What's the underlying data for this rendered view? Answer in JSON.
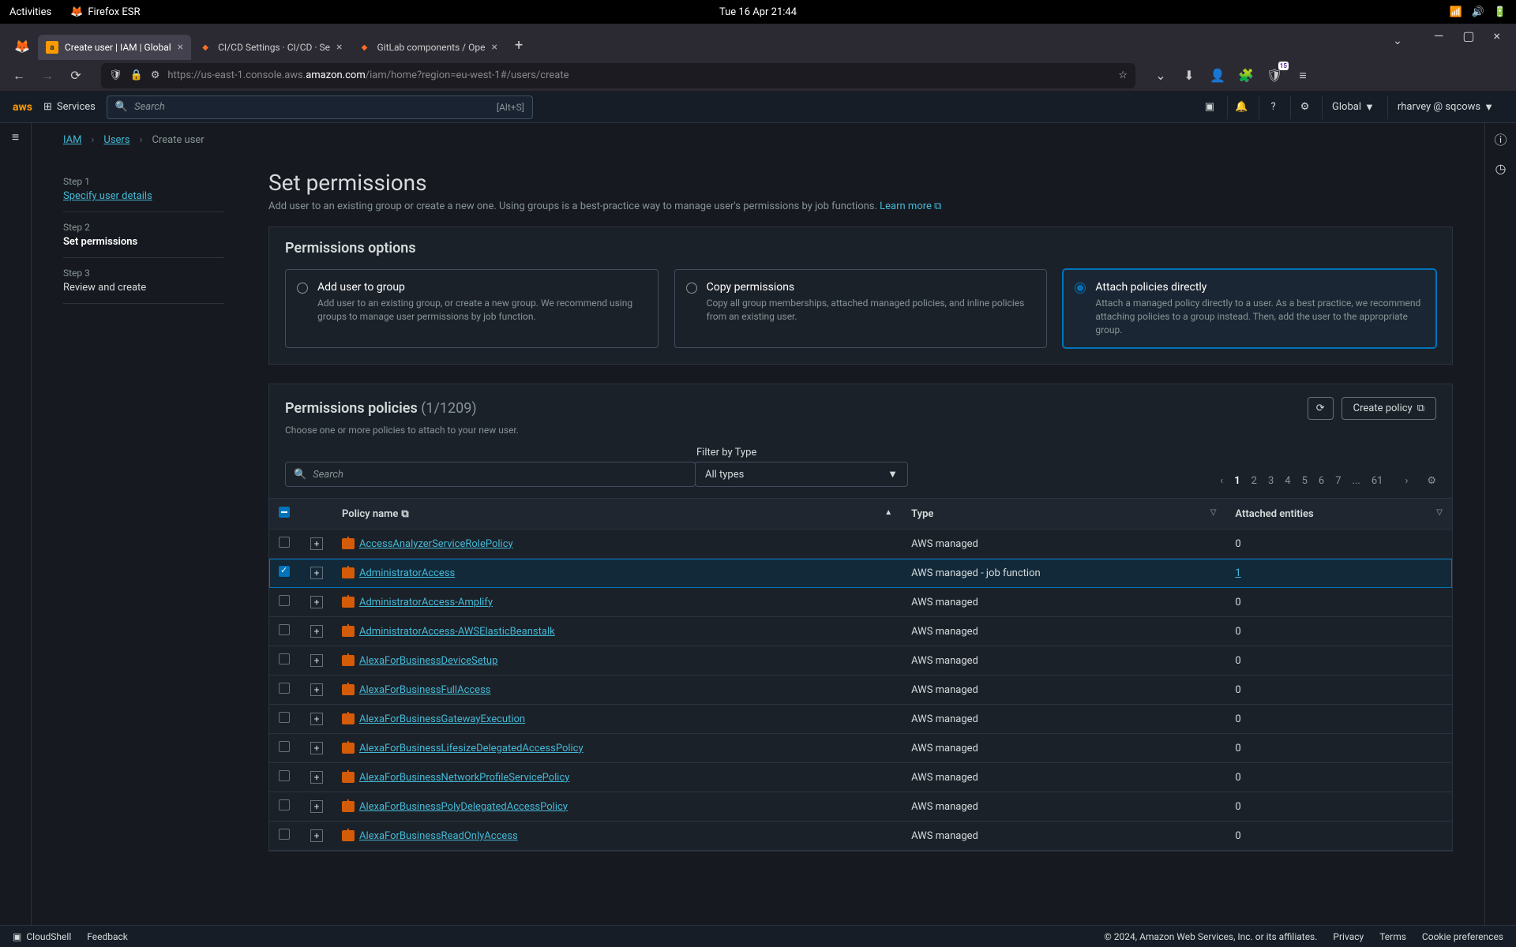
{
  "gnome": {
    "activities": "Activities",
    "app": "Firefox ESR",
    "clock": "Tue 16 Apr  21:44"
  },
  "firefox": {
    "tabs": [
      {
        "title": "Create user | IAM | Global",
        "fav": "aws"
      },
      {
        "title": "CI/CD Settings · CI/CD · Se",
        "fav": "gl"
      },
      {
        "title": "GitLab components / Ope",
        "fav": "gl"
      }
    ],
    "url_pre": "https://us-east-1.console.aws.",
    "url_host": "amazon.com",
    "url_post": "/iam/home?region=eu-west-1#/users/create",
    "ext_badge": "15"
  },
  "aws_header": {
    "services": "Services",
    "search_placeholder": "Search",
    "search_shortcut": "[Alt+S]",
    "region": "Global",
    "account": "rharvey @ sqcows"
  },
  "breadcrumbs": {
    "iam": "IAM",
    "users": "Users",
    "create": "Create user"
  },
  "wizard": {
    "steps": [
      {
        "label": "Step 1",
        "title": "Specify user details",
        "state": "link"
      },
      {
        "label": "Step 2",
        "title": "Set permissions",
        "state": "active"
      },
      {
        "label": "Step 3",
        "title": "Review and create",
        "state": "future"
      }
    ]
  },
  "page": {
    "title": "Set permissions",
    "subtitle_pre": "Add user to an existing group or create a new one. Using groups is a best-practice way to manage user's permissions by job functions. ",
    "learn_more": "Learn more"
  },
  "perm_options": {
    "heading": "Permissions options",
    "cards": [
      {
        "title": "Add user to group",
        "desc": "Add user to an existing group, or create a new group. We recommend using groups to manage user permissions by job function."
      },
      {
        "title": "Copy permissions",
        "desc": "Copy all group memberships, attached managed policies, and inline policies from an existing user."
      },
      {
        "title": "Attach policies directly",
        "desc": "Attach a managed policy directly to a user. As a best practice, we recommend attaching policies to a group instead. Then, add the user to the appropriate group."
      }
    ],
    "selected": 2
  },
  "policies_panel": {
    "heading": "Permissions policies",
    "count": "(1/1209)",
    "sub": "Choose one or more policies to attach to your new user.",
    "create_btn": "Create policy",
    "filter_label": "Filter by Type",
    "search_placeholder": "Search",
    "type_value": "All types",
    "pages": [
      "1",
      "2",
      "3",
      "4",
      "5",
      "6",
      "7",
      "...",
      "61"
    ],
    "columns": {
      "policy": "Policy name",
      "type": "Type",
      "entities": "Attached entities"
    },
    "rows": [
      {
        "name": "AccessAnalyzerServiceRolePolicy",
        "type": "AWS managed",
        "entities": "0",
        "checked": false
      },
      {
        "name": "AdministratorAccess",
        "type": "AWS managed - job function",
        "entities": "1",
        "checked": true,
        "entities_link": true
      },
      {
        "name": "AdministratorAccess-Amplify",
        "type": "AWS managed",
        "entities": "0",
        "checked": false
      },
      {
        "name": "AdministratorAccess-AWSElasticBeanstalk",
        "type": "AWS managed",
        "entities": "0",
        "checked": false
      },
      {
        "name": "AlexaForBusinessDeviceSetup",
        "type": "AWS managed",
        "entities": "0",
        "checked": false
      },
      {
        "name": "AlexaForBusinessFullAccess",
        "type": "AWS managed",
        "entities": "0",
        "checked": false
      },
      {
        "name": "AlexaForBusinessGatewayExecution",
        "type": "AWS managed",
        "entities": "0",
        "checked": false
      },
      {
        "name": "AlexaForBusinessLifesizeDelegatedAccessPolicy",
        "type": "AWS managed",
        "entities": "0",
        "checked": false
      },
      {
        "name": "AlexaForBusinessNetworkProfileServicePolicy",
        "type": "AWS managed",
        "entities": "0",
        "checked": false
      },
      {
        "name": "AlexaForBusinessPolyDelegatedAccessPolicy",
        "type": "AWS managed",
        "entities": "0",
        "checked": false
      },
      {
        "name": "AlexaForBusinessReadOnlyAccess",
        "type": "AWS managed",
        "entities": "0",
        "checked": false
      }
    ]
  },
  "footer": {
    "cloudshell": "CloudShell",
    "feedback": "Feedback",
    "copyright": "© 2024, Amazon Web Services, Inc. or its affiliates.",
    "privacy": "Privacy",
    "terms": "Terms",
    "cookie": "Cookie preferences"
  }
}
